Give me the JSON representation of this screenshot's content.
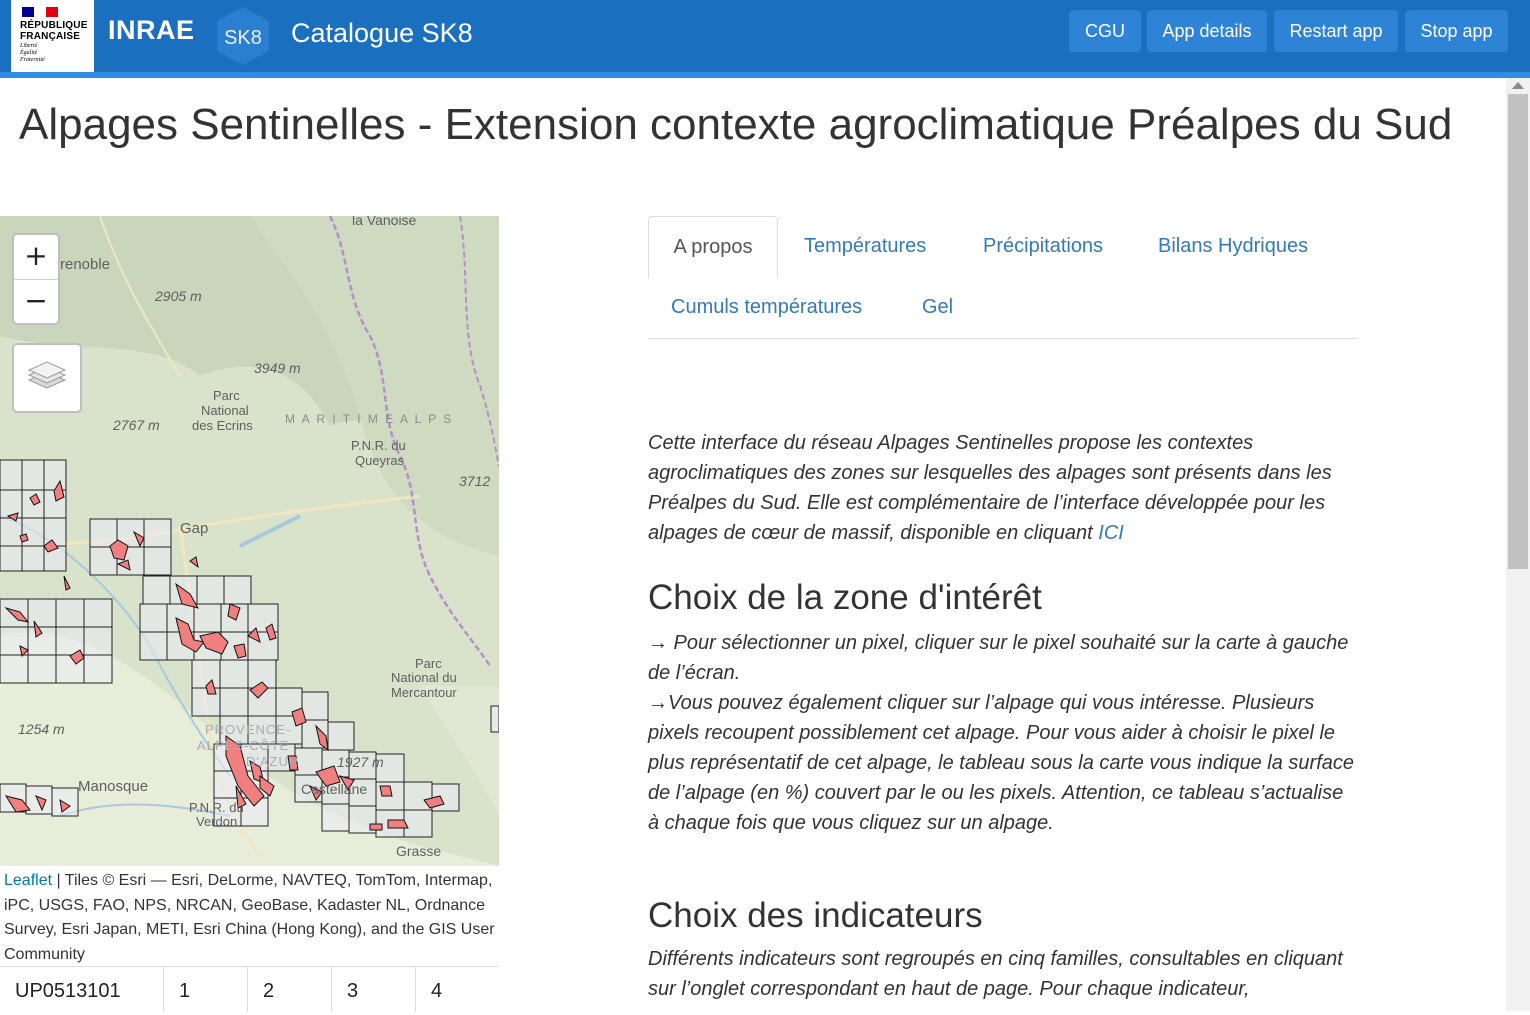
{
  "header": {
    "rf_line1": "RÉPUBLIQUE",
    "rf_line2": "FRANÇAISE",
    "rf_motto": "Liberté\nÉgalité\nFraternité",
    "brand": "INRAE",
    "sk8_badge": "SK8",
    "app_title": "Catalogue SK8",
    "buttons": [
      "CGU",
      "App details",
      "Restart app",
      "Stop app"
    ]
  },
  "page": {
    "title": "Alpages Sentinelles - Extension contexte agroclimatique Préalpes du Sud"
  },
  "map": {
    "zoom_in": "+",
    "zoom_out": "−",
    "layers_icon": "layers-icon",
    "labels": {
      "grenoble": "renoble",
      "vanoise": "la Vanoise",
      "alt_2905": "2905 m",
      "alt_3949": "3949 m",
      "alt_2767": "2767 m",
      "ecrins_1": "Parc",
      "ecrins_2": "National",
      "ecrins_3": "des Ecrins",
      "maritime": "M A R I T I M E   A L P S",
      "queyras_1": "P.N.R. du",
      "queyras_2": "Queyras",
      "alt_3712": "3712",
      "gap": "Gap",
      "mercantour_1": "Parc",
      "mercantour_2": "National du",
      "mercantour_3": "Mercantour",
      "alt_1254": "1254 m",
      "provence_1": "PROVENCE-",
      "provence_2": "ALPES-CÔTE",
      "provence_3": "D'AZUR",
      "alt_1927": "1927 m",
      "manosque": "Manosque",
      "castellane": "Castellane",
      "verdon_1": "P.N.R. du",
      "verdon_2": "Verdon",
      "grasse": "Grasse"
    },
    "attribution_link": "Leaflet",
    "attribution_text": " | Tiles © Esri — Esri, DeLorme, NAVTEQ, TomTom, Intermap, iPC, USGS, FAO, NPS, NRCAN, GeoBase, Kadaster NL, Ordnance Survey, Esri Japan, METI, Esri China (Hong Kong), and the GIS User Community"
  },
  "pixel_table": {
    "cells": [
      "UP0513101",
      "1",
      "2",
      "3",
      "4"
    ]
  },
  "tabs": [
    "A propos",
    "Températures",
    "Précipitations",
    "Bilans Hydriques",
    "Cumuls températures",
    "Gel"
  ],
  "content": {
    "intro": "Cette interface du réseau Alpages Sentinelles propose les contextes agroclimatiques des zones sur lesquelles des alpages sont présents dans les Préalpes du Sud. Elle est complémentaire de l’interface développée pour les alpages de cœur de massif, disponible en cliquant ",
    "intro_link": "ICI",
    "h_zone": "Choix de la zone d'intérêt",
    "zone_p1": "→ Pour sélectionner un pixel, cliquer sur le pixel souhaité sur la carte à gauche de l’écran.",
    "zone_p2": "→Vous pouvez également cliquer sur l’alpage qui vous intéresse. Plusieurs pixels recoupent possiblement cet alpage. Pour vous aider à choisir le pixel le plus représentatif de cet alpage, le tableau sous la carte vous indique la surface de l’alpage (en %) couvert par le ou les pixels. Attention, ce tableau s’actualise à chaque fois que vous cliquez sur un alpage.",
    "h_indic": "Choix des indicateurs",
    "indic_p": "Différents indicateurs sont regroupés en cinq familles, consultables en cliquant sur l’onglet correspondant en haut de page. Pour chaque indicateur,"
  },
  "colors": {
    "header_bg": "#1a6fbf",
    "header_btn": "#2d84d6",
    "link": "#337ab7",
    "alpage_fill": "#f08080"
  }
}
